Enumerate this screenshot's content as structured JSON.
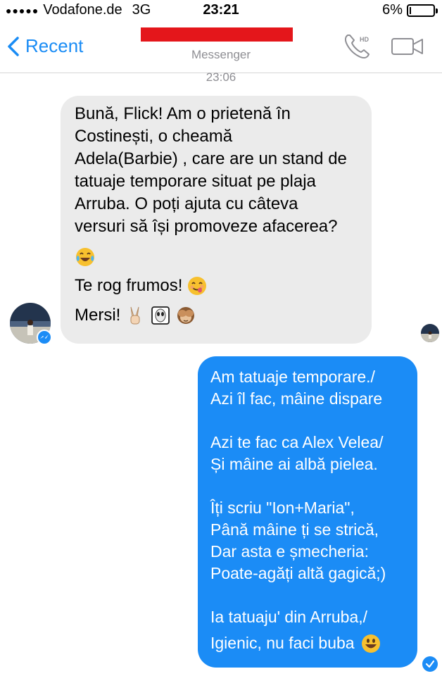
{
  "status_bar": {
    "signal_dots": "●●●●●",
    "carrier": "Vodafone.de",
    "network": "3G",
    "time": "23:21",
    "battery_text": "6%",
    "battery_level": 0.06
  },
  "nav": {
    "back_label": "Recent",
    "subtitle": "Messenger",
    "call_icon": "hd-phone-icon",
    "video_icon": "video-camera-icon"
  },
  "thread": {
    "timestamp": "23:06",
    "incoming": {
      "lines": [
        "Bună, Flick! Am o prietenă în",
        "Costinești, o cheamă",
        "Adela(Barbie) , care are un stand de",
        "tatuaje temporare situat pe plaja",
        "Arruba. O poți ajuta cu câteva",
        "versuri să își promoveze afacerea?"
      ],
      "emoji_line": "tears-of-joy-emoji",
      "please": "Te rog frumos!",
      "please_emoji": "yum-face-emoji",
      "thanks": "Mersi!",
      "thanks_emojis": [
        "victory-hand-emoji",
        "alien-emoji",
        "see-no-evil-monkey-emoji"
      ]
    },
    "outgoing": {
      "stanzas": [
        [
          "Am tatuaje temporare./",
          "Azi îl fac, mâine dispare"
        ],
        [
          "Azi te fac ca Alex Velea/",
          "Și mâine ai albă pielea."
        ],
        [
          "Îți scriu \"Ion+Maria\",",
          "Până mâine ți se strică,",
          "Dar asta e șmecheria:",
          "Poate-agăți altă gagică;)"
        ],
        [
          "Ia tatuaju' din Arruba,/",
          "Igienic, nu faci buba"
        ]
      ],
      "end_emoji": "smiley-emoji"
    }
  },
  "colors": {
    "accent": "#1b8cf6",
    "incoming_bubble": "#ebebeb",
    "redaction": "#e4161b"
  }
}
